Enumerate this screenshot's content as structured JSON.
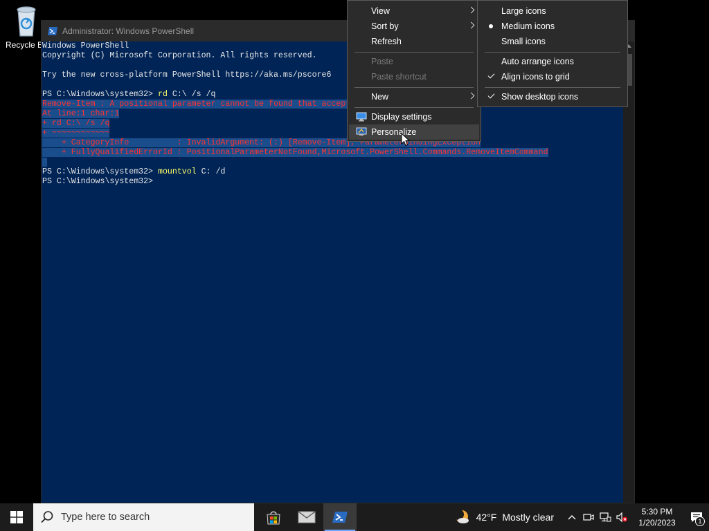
{
  "desktop": {
    "recycle_bin_label": "Recycle Bin"
  },
  "window": {
    "title": "Administrator: Windows PowerShell"
  },
  "console": {
    "lines": [
      {
        "text": "Windows PowerShell",
        "type": "normal"
      },
      {
        "text": "Copyright (C) Microsoft Corporation. All rights reserved.",
        "type": "normal"
      },
      {
        "text": "",
        "type": "normal"
      },
      {
        "text": "Try the new cross-platform PowerShell https://aka.ms/pscore6",
        "type": "normal"
      },
      {
        "text": "",
        "type": "normal"
      },
      {
        "prompt": "PS C:\\Windows\\system32> ",
        "cmd": "rd",
        "args": " C:\\ /s /q",
        "type": "command"
      },
      {
        "text": "Remove-Item : A positional parameter cannot be found that accepts argument '/q'.",
        "type": "error"
      },
      {
        "text": "At line:1 char:1",
        "type": "error"
      },
      {
        "text": "+ rd C:\\ /s /q",
        "type": "error"
      },
      {
        "text": "+ ~~~~~~~~~~~~",
        "type": "error"
      },
      {
        "text": "    + CategoryInfo          : InvalidArgument: (:) [Remove-Item], ParameterBindingException",
        "type": "error"
      },
      {
        "text": "    + FullyQualifiedErrorId : PositionalParameterNotFound,Microsoft.PowerShell.Commands.RemoveItemCommand",
        "type": "error"
      },
      {
        "text": " ",
        "type": "normal"
      },
      {
        "prompt": "PS C:\\Windows\\system32> ",
        "cmd": "mountvol",
        "args": " C: /d",
        "type": "command"
      },
      {
        "text": "PS C:\\Windows\\system32>",
        "type": "normal"
      }
    ]
  },
  "context_menu": {
    "view": "View",
    "sort_by": "Sort by",
    "refresh": "Refresh",
    "paste": "Paste",
    "paste_shortcut": "Paste shortcut",
    "new": "New",
    "display_settings": "Display settings",
    "personalize": "Personalize"
  },
  "view_submenu": {
    "large_icons": "Large icons",
    "medium_icons": "Medium icons",
    "small_icons": "Small icons",
    "auto_arrange": "Auto arrange icons",
    "align_to_grid": "Align icons to grid",
    "show_desktop_icons": "Show desktop icons"
  },
  "taskbar": {
    "search_placeholder": "Type here to search",
    "weather_temp": "42°F",
    "weather_condition": "Mostly clear",
    "time": "5:30 PM",
    "date": "1/20/2023",
    "notification_count": "1"
  },
  "colors": {
    "console_bg": "#012456",
    "taskbar_bg": "#1c1c1c",
    "menu_bg": "#2b2b2b",
    "error_text": "#ff3333",
    "command_text": "#ffff66"
  }
}
